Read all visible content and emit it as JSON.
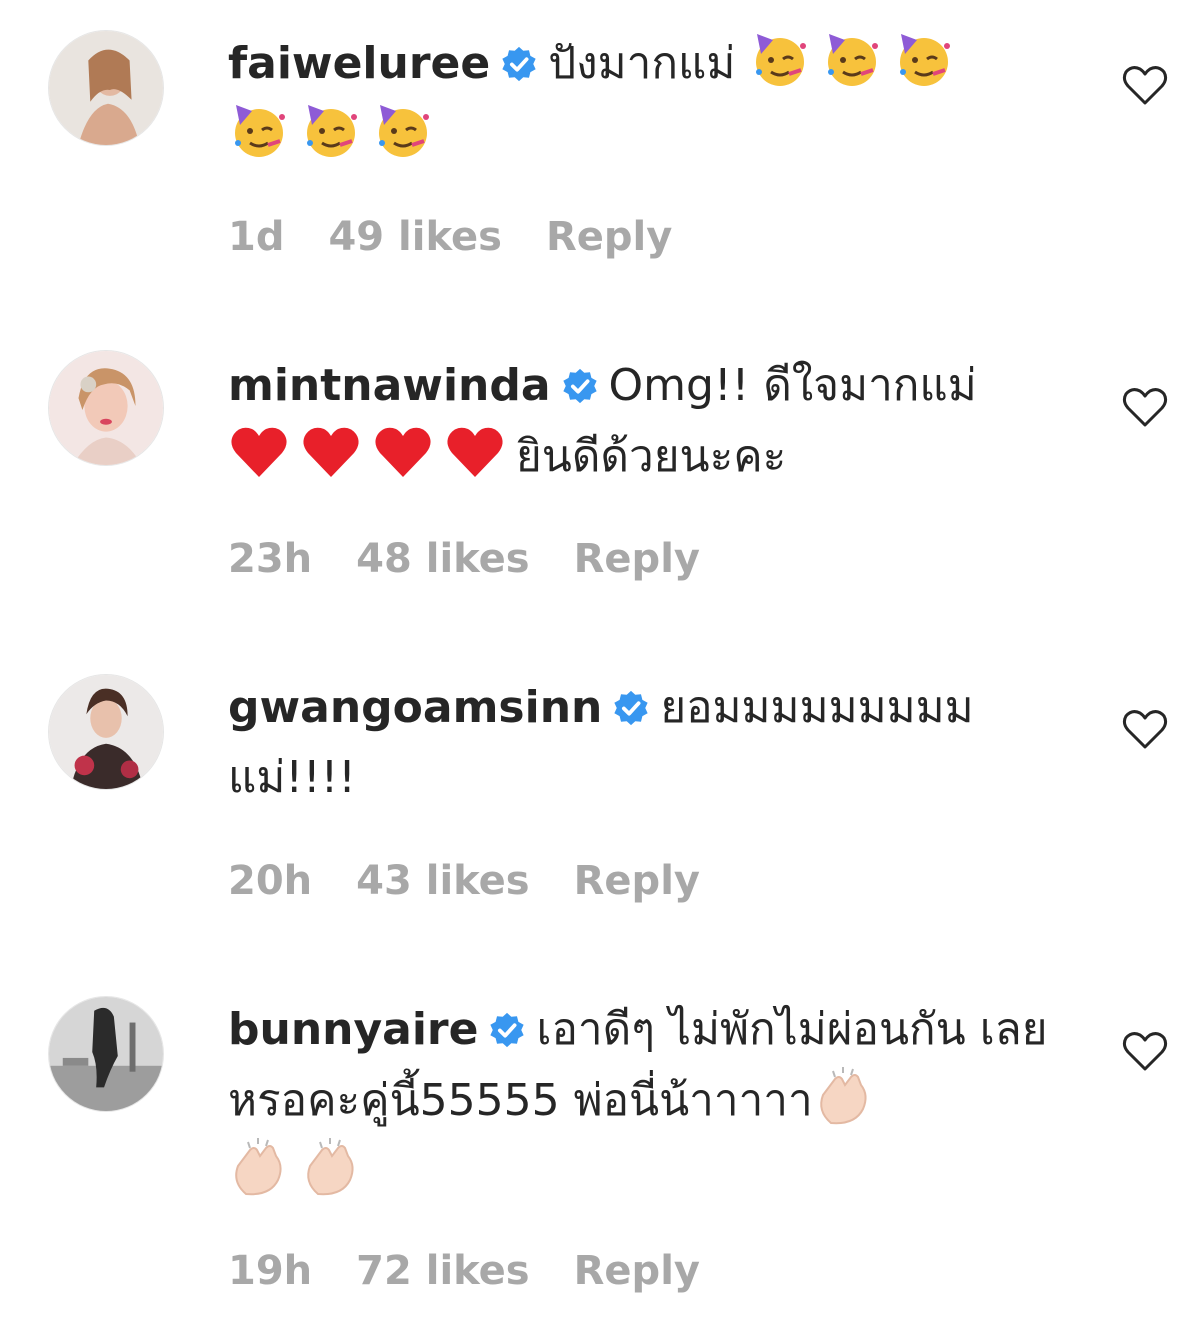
{
  "comments": [
    {
      "username": "faiweluree",
      "text_before": "ปังมากแม่",
      "text_after": "",
      "time": "1d",
      "likes": "49 likes",
      "reply": "Reply",
      "emojis": [
        "partying-face",
        "partying-face",
        "partying-face",
        "partying-face",
        "partying-face",
        "partying-face"
      ]
    },
    {
      "username": "mintnawinda",
      "text_before": "Omg!! ดีใจมากแม่",
      "text_after": "ยินดีด้วยนะคะ",
      "time": "23h",
      "likes": "48 likes",
      "reply": "Reply",
      "emojis": [
        "red-heart",
        "red-heart",
        "red-heart",
        "red-heart"
      ]
    },
    {
      "username": "gwangoamsinn",
      "text_before": "ยอมมมมมมมมม แม่!!!!",
      "text_after": "",
      "time": "20h",
      "likes": "43 likes",
      "reply": "Reply",
      "emojis": []
    },
    {
      "username": "bunnyaire",
      "text_before": "เอาดีๆ ไม่พักไม่ผ่อนกัน เลยหรอคะคู่นี้55555 พ่อนี่น้าาาาา",
      "text_after": "",
      "time": "19h",
      "likes": "72 likes",
      "reply": "Reply",
      "emojis": [
        "clapping-hands",
        "clapping-hands",
        "clapping-hands"
      ]
    }
  ],
  "colors": {
    "username": "#262626",
    "meta": "#a8a8a8",
    "verified": "#3897f0",
    "heart_outline": "#262626"
  }
}
